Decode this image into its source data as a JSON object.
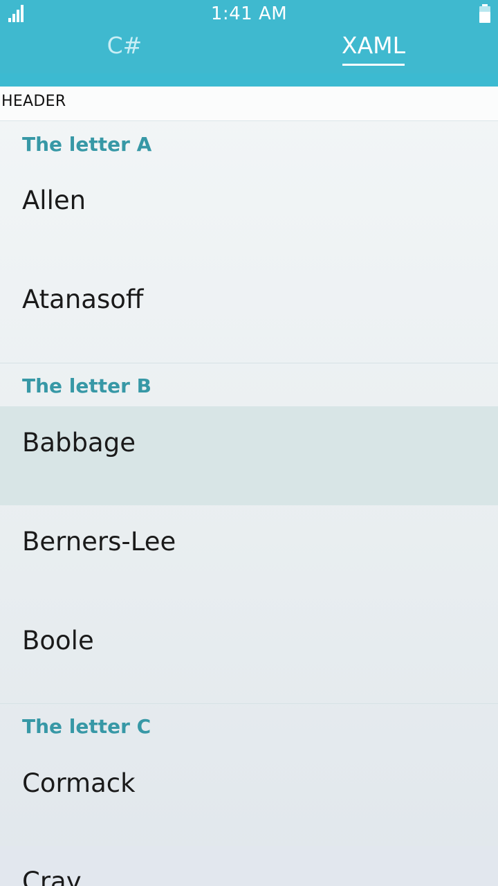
{
  "status_bar": {
    "time": "1:41 AM",
    "signal_icon": "signal-bars-icon",
    "battery_icon": "battery-icon"
  },
  "tabs": [
    {
      "label": "C#",
      "selected": false
    },
    {
      "label": "XAML",
      "selected": true
    }
  ],
  "list": {
    "header": "HEADER",
    "groups": [
      {
        "title": "The letter A",
        "items": [
          "Allen",
          "Atanasoff"
        ]
      },
      {
        "title": "The letter B",
        "items": [
          "Babbage",
          "Berners-Lee",
          "Boole"
        ]
      },
      {
        "title": "The letter C",
        "items": [
          "Cormack",
          "Cray"
        ]
      }
    ],
    "selected_item": "Babbage"
  },
  "colors": {
    "app_bar": "#3fb9cf",
    "group_header_text": "#3798a6",
    "selected_row": "#d8e5e6"
  }
}
